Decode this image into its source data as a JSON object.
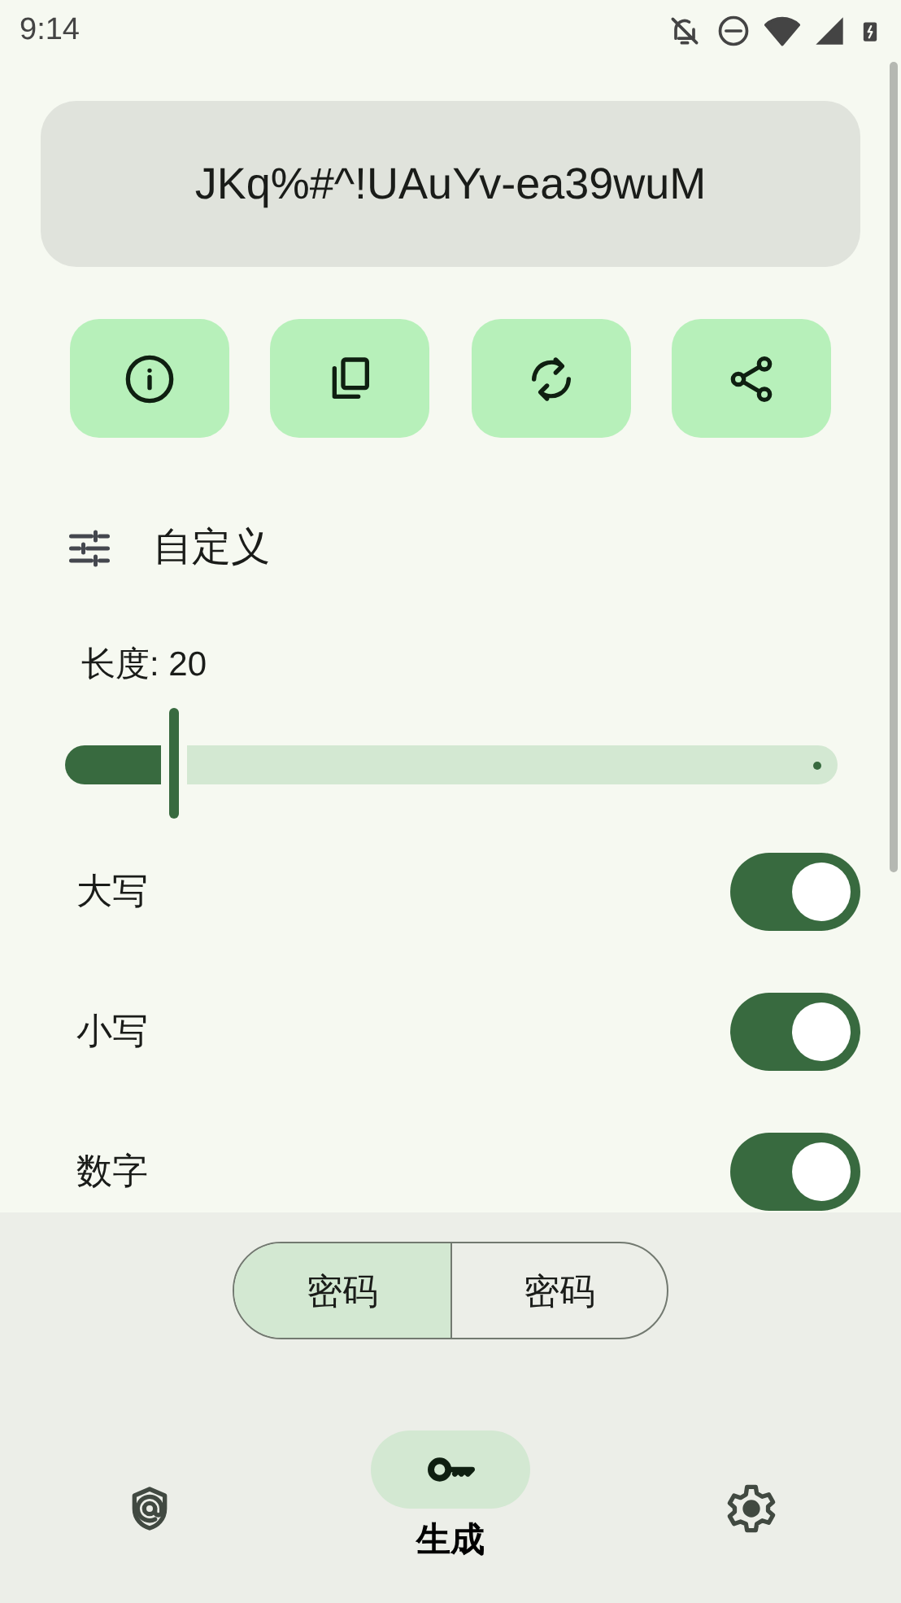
{
  "status_bar": {
    "time": "9:14"
  },
  "password": {
    "value": "JKq%#^!UAuYv-ea39wuM"
  },
  "actions": [
    {
      "kind": "info"
    },
    {
      "kind": "copy"
    },
    {
      "kind": "refresh"
    },
    {
      "kind": "share"
    }
  ],
  "section": {
    "title": "自定义"
  },
  "length": {
    "label": "长度: 20",
    "level": 0.14
  },
  "options": [
    {
      "label": "大写",
      "on": true
    },
    {
      "label": "小写",
      "on": true
    },
    {
      "label": "数字",
      "on": true
    }
  ],
  "mode": [
    {
      "label": "密码",
      "selected": true
    },
    {
      "label": "密码",
      "selected": false
    }
  ],
  "nav": [
    {
      "kind": "shield",
      "selected": false
    },
    {
      "kind": "key",
      "label": "生成",
      "selected": true
    },
    {
      "kind": "gear",
      "selected": false
    }
  ]
}
